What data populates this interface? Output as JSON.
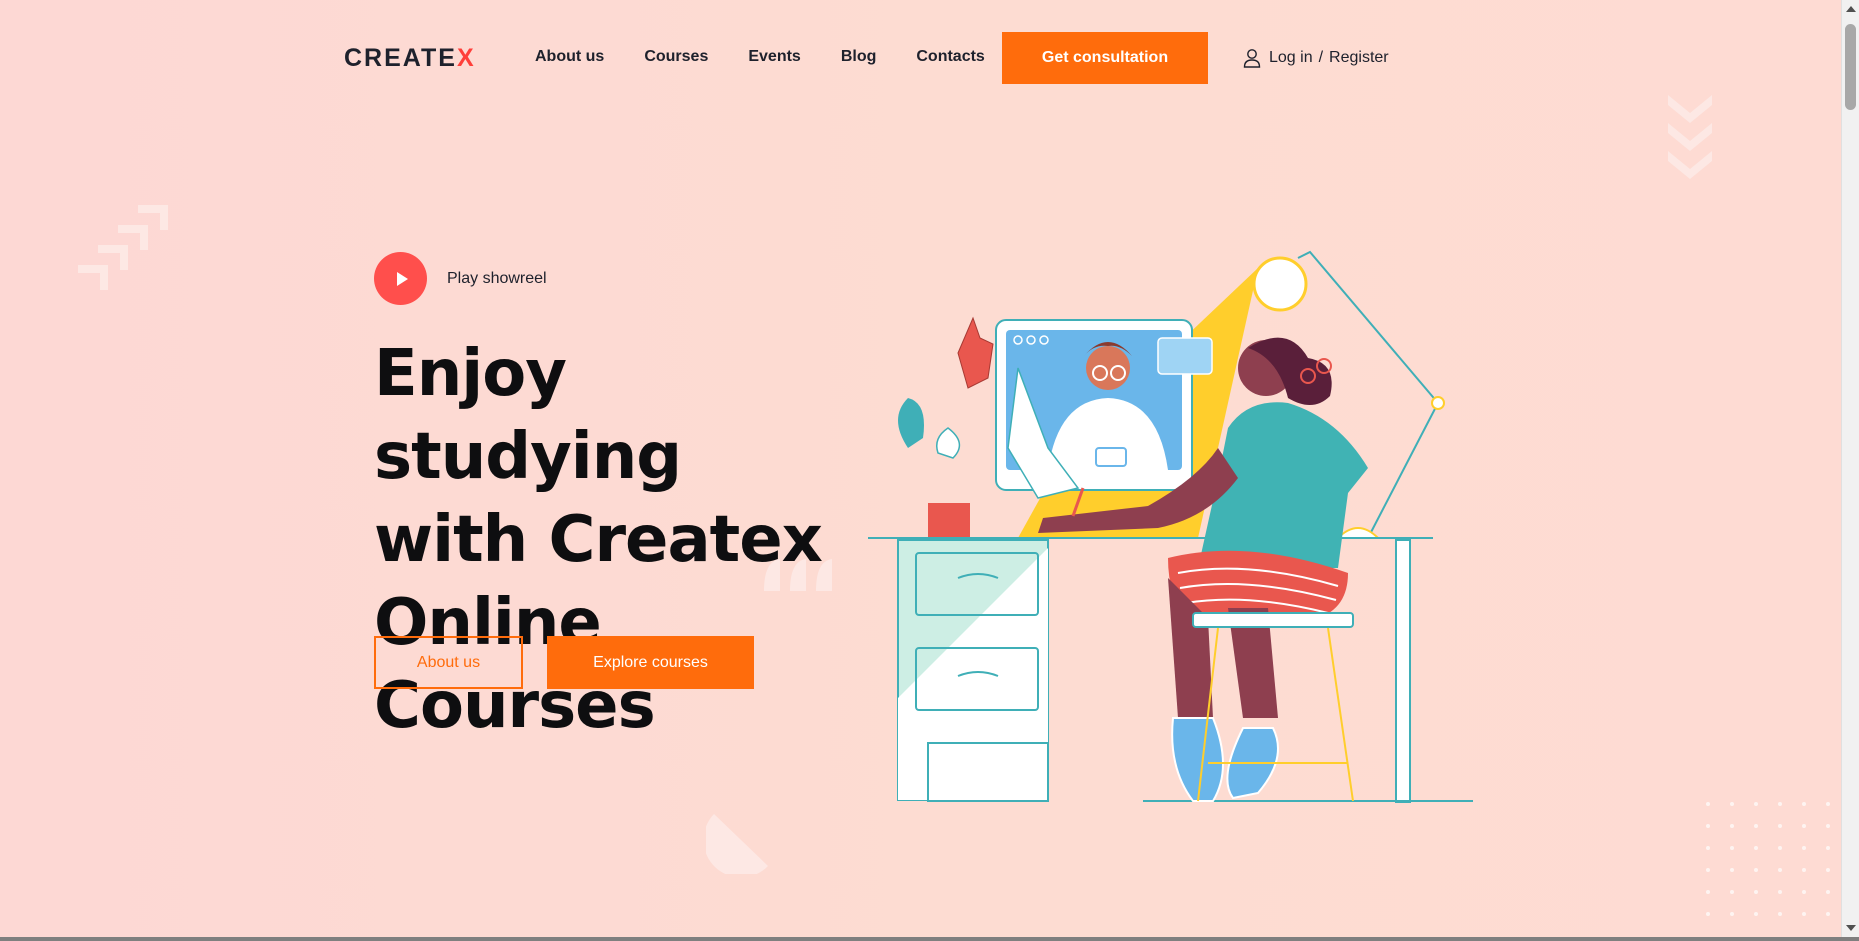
{
  "brand": {
    "logo_main": "CREATE",
    "logo_x": "X"
  },
  "nav": {
    "items": [
      {
        "label": "About us"
      },
      {
        "label": "Courses"
      },
      {
        "label": "Events"
      },
      {
        "label": "Blog"
      },
      {
        "label": "Contacts"
      }
    ],
    "cta_label": "Get consultation",
    "login_label": "Log in",
    "separator": "/",
    "register_label": "Register"
  },
  "hero": {
    "play_label": "Play showreel",
    "title_lines": [
      "Enjoy studying",
      "with Createx",
      "Online Courses"
    ],
    "about_button": "About us",
    "explore_button": "Explore courses"
  },
  "colors": {
    "accent": "#ff6c0c",
    "play": "#ff4f4c",
    "background": "#fdd8d4",
    "text": "#1e212c"
  },
  "icons": [
    "user-icon",
    "play-icon",
    "logo-x-icon"
  ]
}
